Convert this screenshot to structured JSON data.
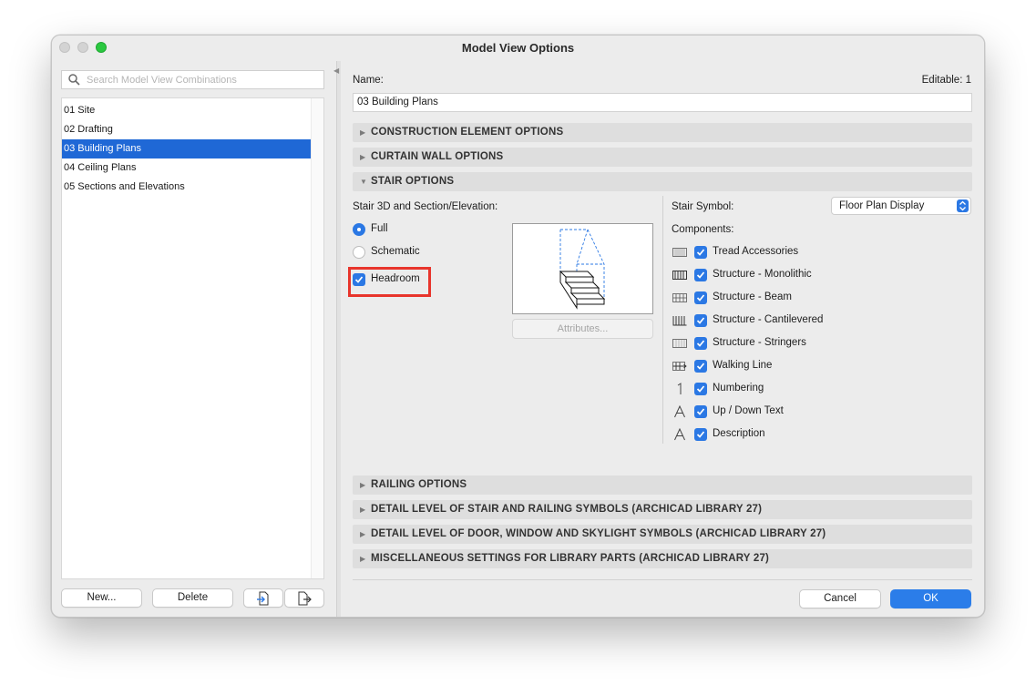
{
  "window": {
    "title": "Model View Options"
  },
  "sidebar": {
    "search_placeholder": "Search Model View Combinations",
    "items": [
      {
        "label": "01 Site"
      },
      {
        "label": "02 Drafting"
      },
      {
        "label": "03 Building Plans",
        "selected": true
      },
      {
        "label": "04 Ceiling Plans"
      },
      {
        "label": "05 Sections and Elevations"
      }
    ],
    "buttons": {
      "new": "New...",
      "delete": "Delete"
    }
  },
  "main": {
    "name_label": "Name:",
    "editable_label": "Editable: 1",
    "name_value": "03 Building Plans",
    "sections": {
      "construction": "CONSTRUCTION ELEMENT OPTIONS",
      "curtain_wall": "CURTAIN WALL OPTIONS",
      "stair": "STAIR OPTIONS",
      "railing": "RAILING OPTIONS",
      "detail_stair": "DETAIL LEVEL OF STAIR AND RAILING SYMBOLS (ARCHICAD LIBRARY 27)",
      "detail_door": "DETAIL LEVEL OF DOOR, WINDOW AND SKYLIGHT SYMBOLS (ARCHICAD LIBRARY 27)",
      "misc": "MISCELLANEOUS SETTINGS FOR LIBRARY PARTS (ARCHICAD LIBRARY 27)"
    },
    "stair": {
      "mode_label": "Stair 3D and Section/Elevation:",
      "full_label": "Full",
      "schematic_label": "Schematic",
      "headroom_label": "Headroom",
      "attributes_label": "Attributes...",
      "symbol_label": "Stair Symbol:",
      "symbol_value": "Floor Plan Display",
      "components_label": "Components:",
      "components": [
        {
          "label": "Tread Accessories",
          "icon": "tread-accessories-icon",
          "checked": true
        },
        {
          "label": "Structure - Monolithic",
          "icon": "structure-monolithic-icon",
          "checked": true
        },
        {
          "label": "Structure - Beam",
          "icon": "structure-beam-icon",
          "checked": true
        },
        {
          "label": "Structure - Cantilevered",
          "icon": "structure-cantilevered-icon",
          "checked": true
        },
        {
          "label": "Structure - Stringers",
          "icon": "structure-stringers-icon",
          "checked": true
        },
        {
          "label": "Walking Line",
          "icon": "walking-line-icon",
          "checked": true
        },
        {
          "label": "Numbering",
          "icon": "numbering-icon",
          "checked": true
        },
        {
          "label": "Up / Down Text",
          "icon": "up-down-text-icon",
          "checked": true
        },
        {
          "label": "Description",
          "icon": "description-icon",
          "checked": true
        }
      ]
    },
    "buttons": {
      "cancel": "Cancel",
      "ok": "OK"
    }
  },
  "colors": {
    "accent": "#2b78e4",
    "selection": "#1f68d6",
    "highlight": "#e8352c",
    "maximize": "#2ac840"
  }
}
